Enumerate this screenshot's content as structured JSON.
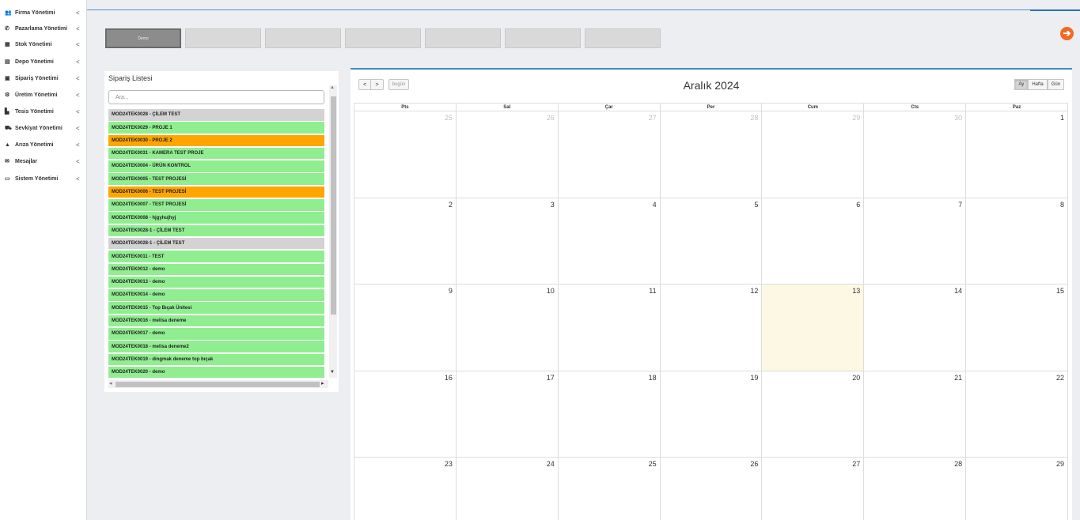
{
  "sidebar": {
    "items": [
      {
        "label": "Firma Yönetimi",
        "icon": "users-icon"
      },
      {
        "label": "Pazarlama Yönetimi",
        "icon": "phone-icon"
      },
      {
        "label": "Stok Yönetimi",
        "icon": "cubes-icon"
      },
      {
        "label": "Depo Yönetimi",
        "icon": "warehouse-icon"
      },
      {
        "label": "Sipariş Yönetimi",
        "icon": "briefcase-icon"
      },
      {
        "label": "Üretim Yönetimi",
        "icon": "gears-icon"
      },
      {
        "label": "Tesis Yönetimi",
        "icon": "industry-icon"
      },
      {
        "label": "Sevkiyat Yönetimi",
        "icon": "truck-icon"
      },
      {
        "label": "Arıza Yönetimi",
        "icon": "warning-icon"
      },
      {
        "label": "Mesajlar",
        "icon": "comments-icon"
      },
      {
        "label": "Sistem Yönetimi",
        "icon": "desktop-icon"
      }
    ],
    "chevron": "<"
  },
  "tabs": [
    {
      "label": "Demo",
      "active": true
    },
    {
      "label": "",
      "active": false
    },
    {
      "label": "",
      "active": false
    },
    {
      "label": "",
      "active": false
    },
    {
      "label": "",
      "active": false
    },
    {
      "label": "",
      "active": false
    },
    {
      "label": "",
      "active": false
    }
  ],
  "top_action": {
    "icon": "arrow-right-circle-icon",
    "color": "#f26a21"
  },
  "orders": {
    "title": "Sipariş Listesi",
    "search_placeholder": "Ara...",
    "items": [
      {
        "label": "MOD24TEK0028 - ÇİLEM TEST",
        "status": "gray"
      },
      {
        "label": "MOD24TEK0029 - PROJE 1",
        "status": "green"
      },
      {
        "label": "MOD24TEK0030 - PROJE 2",
        "status": "orange"
      },
      {
        "label": "MOD24TEK0031 - KAMERA TEST PROJE",
        "status": "green"
      },
      {
        "label": "MOD24TEK0004 - ÜRÜN KONTROL",
        "status": "green"
      },
      {
        "label": "MOD24TEK0005 - TEST PROJESİ",
        "status": "green"
      },
      {
        "label": "MOD24TEK0006 - TEST PROJESİ",
        "status": "orange"
      },
      {
        "label": "MOD24TEK0007 - TEST PROJESİ",
        "status": "green"
      },
      {
        "label": "MOD24TEK0008 - hjgyhujhyj",
        "status": "green"
      },
      {
        "label": "MOD24TEK0028-1 - ÇİLEM TEST",
        "status": "green"
      },
      {
        "label": "MOD24TEK0028-1 - ÇİLEM TEST",
        "status": "gray"
      },
      {
        "label": "MOD24TEK0011 - TEST",
        "status": "green"
      },
      {
        "label": "MOD24TEK0012 - demo",
        "status": "green"
      },
      {
        "label": "MOD24TEK0013 - demo",
        "status": "green"
      },
      {
        "label": "MOD24TEK0014 - demo",
        "status": "green"
      },
      {
        "label": "MOD24TEK0015 - Top Bıçak Ünitesi",
        "status": "green"
      },
      {
        "label": "MOD24TEK0016 - melisa deneme",
        "status": "green"
      },
      {
        "label": "MOD24TEK0017 - demo",
        "status": "green"
      },
      {
        "label": "MOD24TEK0018 - melisa deneme2",
        "status": "green"
      },
      {
        "label": "MOD24TEK0019 - dingmak deneme top bıçak",
        "status": "green"
      },
      {
        "label": "MOD24TEK0020 - demo",
        "status": "green"
      }
    ],
    "status_colors": {
      "gray": "#d3d3d3",
      "green": "#90ee90",
      "orange": "#ffa500"
    }
  },
  "calendar": {
    "title": "Aralık 2024",
    "prev_label": "<",
    "next_label": ">",
    "today_label": "bugün",
    "views": [
      {
        "label": "Ay",
        "active": true
      },
      {
        "label": "Hafta",
        "active": false
      },
      {
        "label": "Gün",
        "active": false
      }
    ],
    "weekdays": [
      "Pts",
      "Sal",
      "Çar",
      "Per",
      "Cum",
      "Cts",
      "Paz"
    ],
    "weeks": [
      [
        {
          "d": "25",
          "other": true
        },
        {
          "d": "26",
          "other": true
        },
        {
          "d": "27",
          "other": true
        },
        {
          "d": "28",
          "other": true
        },
        {
          "d": "29",
          "other": true
        },
        {
          "d": "30",
          "other": true
        },
        {
          "d": "1"
        }
      ],
      [
        {
          "d": "2"
        },
        {
          "d": "3"
        },
        {
          "d": "4"
        },
        {
          "d": "5"
        },
        {
          "d": "6"
        },
        {
          "d": "7"
        },
        {
          "d": "8"
        }
      ],
      [
        {
          "d": "9"
        },
        {
          "d": "10"
        },
        {
          "d": "11"
        },
        {
          "d": "12"
        },
        {
          "d": "13",
          "today": true
        },
        {
          "d": "14"
        },
        {
          "d": "15"
        }
      ],
      [
        {
          "d": "16"
        },
        {
          "d": "17"
        },
        {
          "d": "18"
        },
        {
          "d": "19"
        },
        {
          "d": "20"
        },
        {
          "d": "21"
        },
        {
          "d": "22"
        }
      ],
      [
        {
          "d": "23"
        },
        {
          "d": "24"
        },
        {
          "d": "25"
        },
        {
          "d": "26"
        },
        {
          "d": "27"
        },
        {
          "d": "28"
        },
        {
          "d": "29"
        }
      ]
    ],
    "today_color": "#fcf8e3",
    "accent_color": "#3c8dbc"
  }
}
